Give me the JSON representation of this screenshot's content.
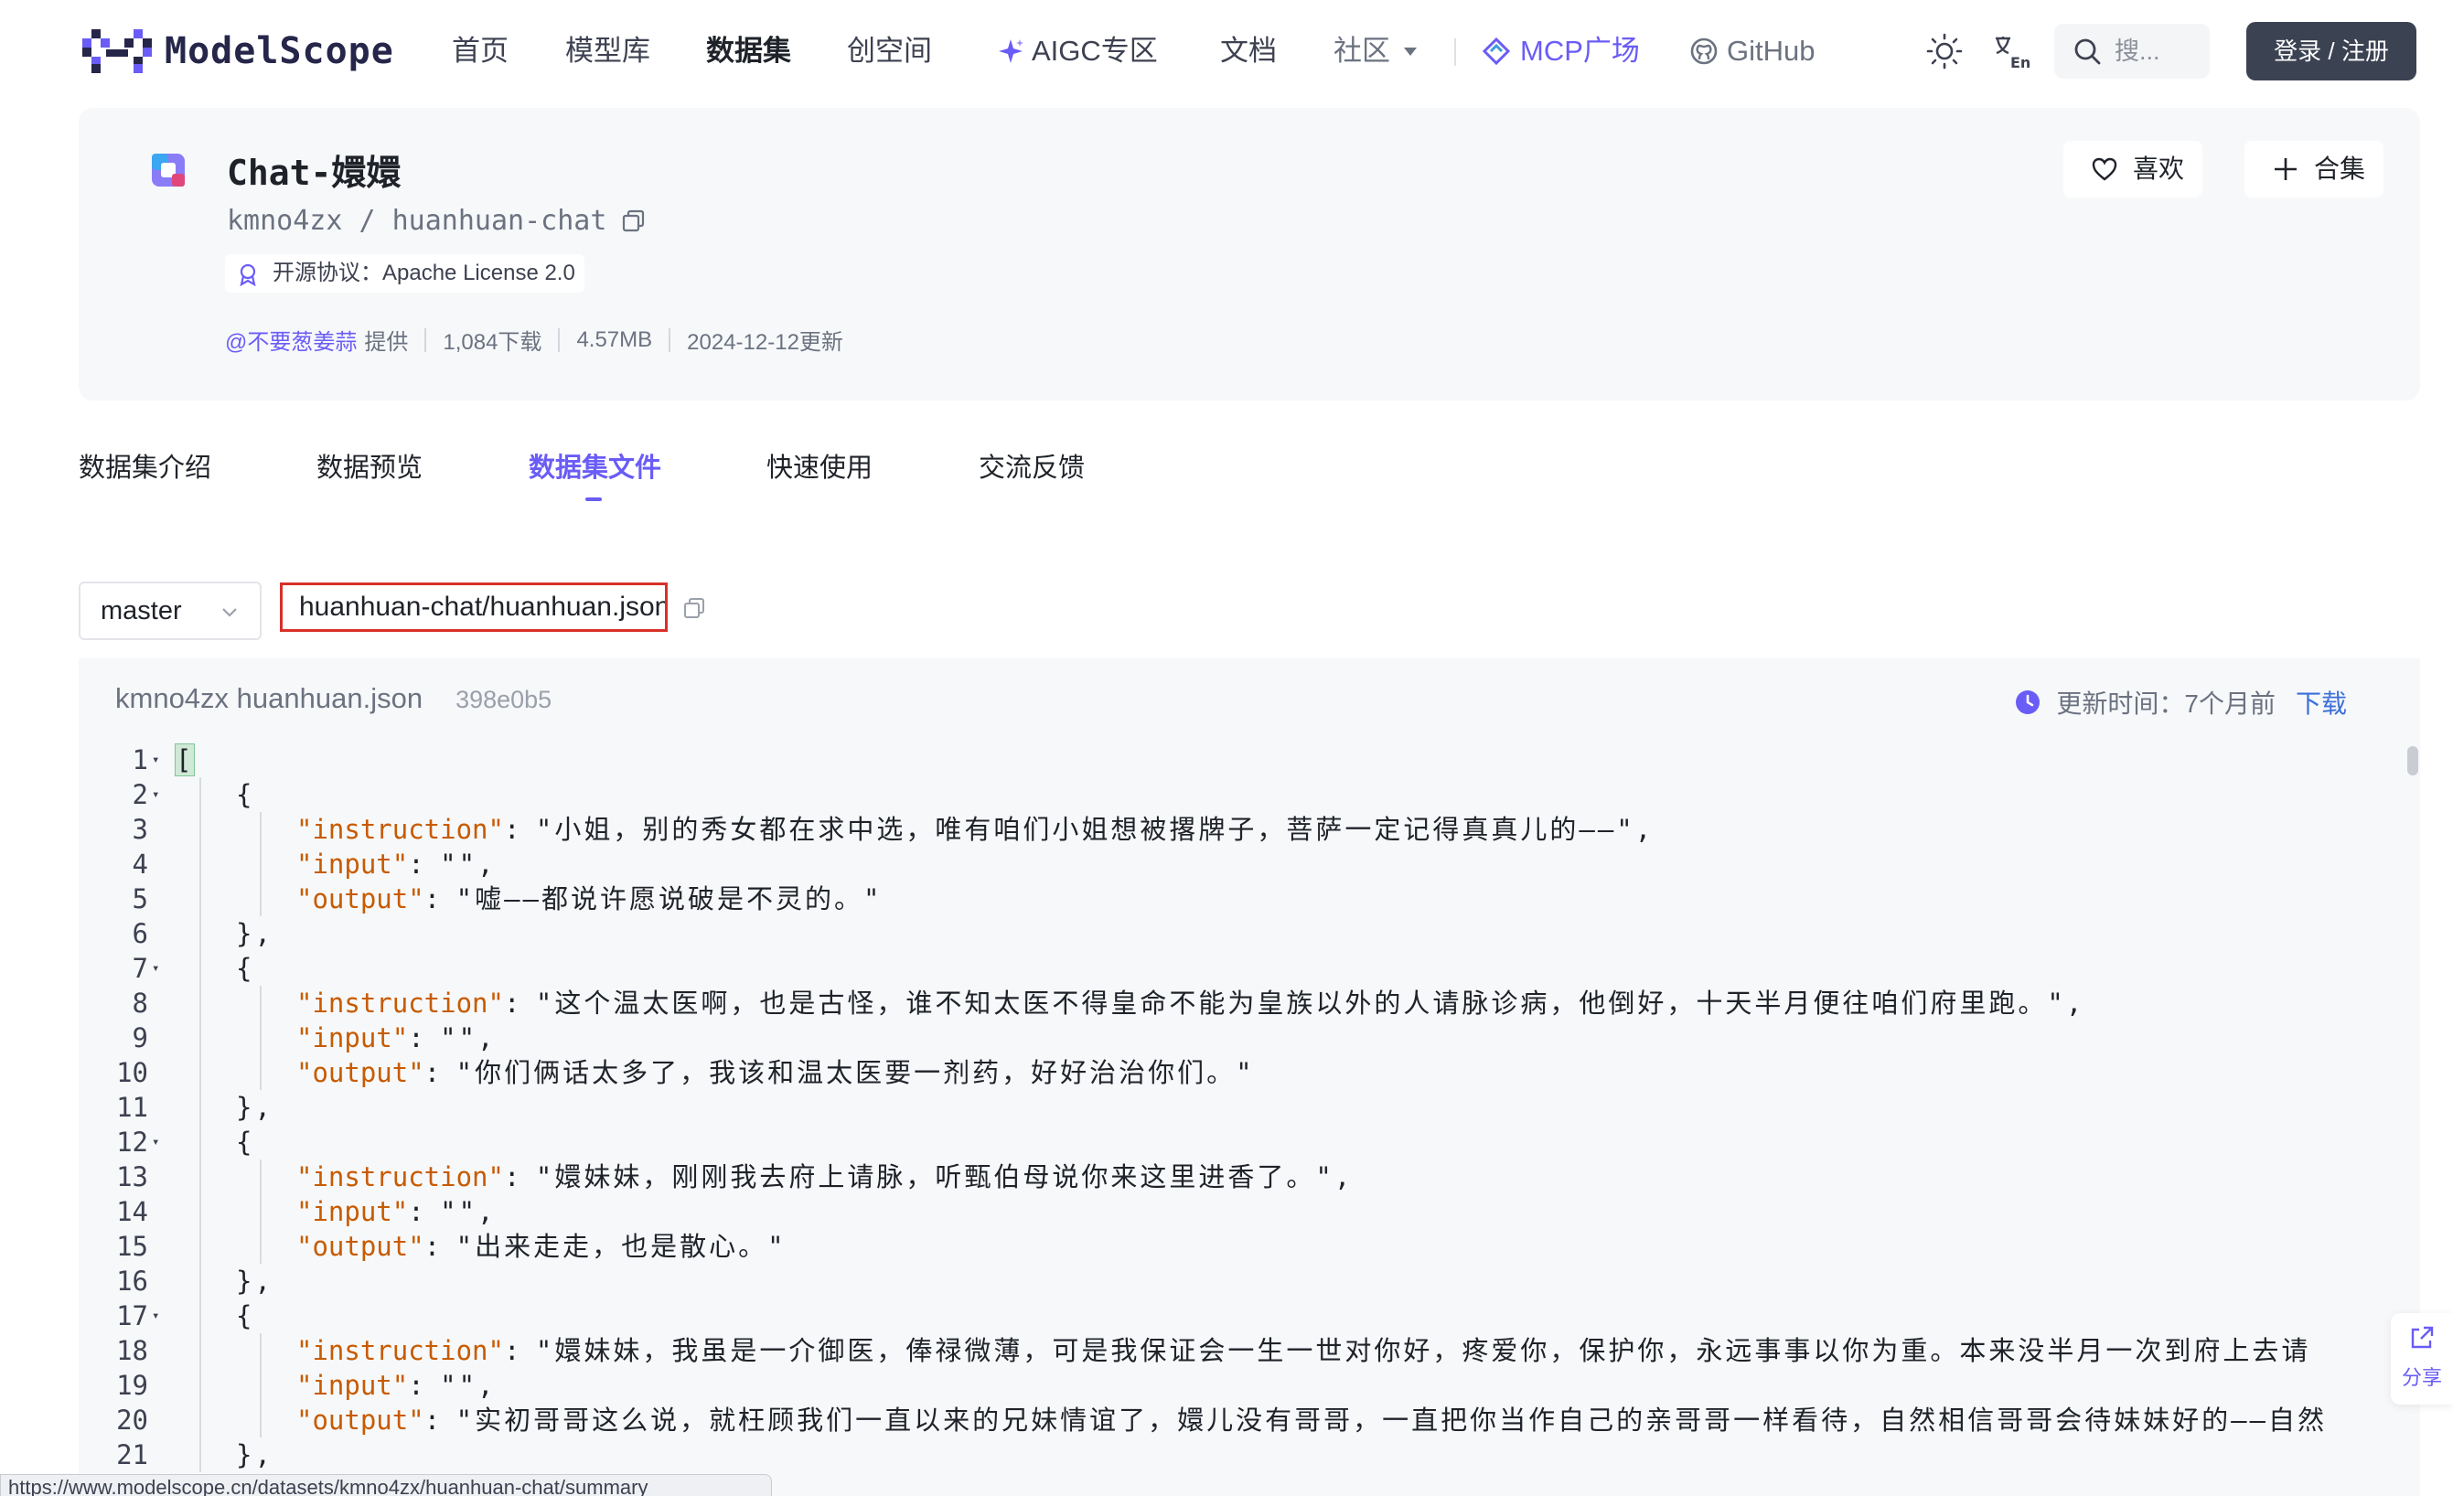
{
  "nav": {
    "logo_text": "ModelScope",
    "items": [
      {
        "id": "home",
        "label": "首页"
      },
      {
        "id": "models",
        "label": "模型库"
      },
      {
        "id": "datasets",
        "label": "数据集"
      },
      {
        "id": "studios",
        "label": "创空间"
      },
      {
        "id": "aigc",
        "label": "AIGC专区"
      },
      {
        "id": "docs",
        "label": "文档"
      },
      {
        "id": "community",
        "label": "社区"
      },
      {
        "id": "mcp",
        "label": "MCP广场"
      },
      {
        "id": "github",
        "label": "GitHub"
      }
    ],
    "search_placeholder": "搜...",
    "login_label": "登录 / 注册"
  },
  "dataset": {
    "title": "Chat-嬛嬛",
    "path": "kmno4zx / huanhuan-chat",
    "license": "开源协议：Apache License 2.0",
    "provider": "@不要葱姜蒜",
    "provider_suffix": "提供",
    "downloads": "1,084下载",
    "size": "4.57MB",
    "updated": "2024-12-12更新",
    "like_label": "喜欢",
    "collect_label": "合集"
  },
  "tabs": [
    {
      "label": "数据集介绍",
      "active": false
    },
    {
      "label": "数据预览",
      "active": false
    },
    {
      "label": "数据集文件",
      "active": true
    },
    {
      "label": "快速使用",
      "active": false
    },
    {
      "label": "交流反馈",
      "active": false
    }
  ],
  "file": {
    "branch": "master",
    "path": "huanhuan-chat/huanhuan.json",
    "header_name": "kmno4zx huanhuan.json",
    "commit": "398e0b5",
    "updated_label": "更新时间：7个月前",
    "download_label": "下载"
  },
  "code_lines": [
    {
      "n": "1",
      "fold": true,
      "indent": 0,
      "type": "bracket",
      "text": "["
    },
    {
      "n": "2",
      "fold": true,
      "indent": 1,
      "type": "brace",
      "text": "{"
    },
    {
      "n": "3",
      "fold": false,
      "indent": 2,
      "type": "kv",
      "key": "\"instruction\"",
      "val": "\"小姐，别的秀女都在求中选，唯有咱们小姐想被撂牌子，菩萨一定记得真真儿的——\"",
      "tail": ","
    },
    {
      "n": "4",
      "fold": false,
      "indent": 2,
      "type": "kv",
      "key": "\"input\"",
      "val": "\"\"",
      "tail": ","
    },
    {
      "n": "5",
      "fold": false,
      "indent": 2,
      "type": "kv",
      "key": "\"output\"",
      "val": "\"嘘——都说许愿说破是不灵的。\"",
      "tail": ""
    },
    {
      "n": "6",
      "fold": false,
      "indent": 1,
      "type": "brace",
      "text": "},"
    },
    {
      "n": "7",
      "fold": true,
      "indent": 1,
      "type": "brace",
      "text": "{"
    },
    {
      "n": "8",
      "fold": false,
      "indent": 2,
      "type": "kv",
      "key": "\"instruction\"",
      "val": "\"这个温太医啊，也是古怪，谁不知太医不得皇命不能为皇族以外的人请脉诊病，他倒好，十天半月便往咱们府里跑。\"",
      "tail": ","
    },
    {
      "n": "9",
      "fold": false,
      "indent": 2,
      "type": "kv",
      "key": "\"input\"",
      "val": "\"\"",
      "tail": ","
    },
    {
      "n": "10",
      "fold": false,
      "indent": 2,
      "type": "kv",
      "key": "\"output\"",
      "val": "\"你们俩话太多了，我该和温太医要一剂药，好好治治你们。\"",
      "tail": ""
    },
    {
      "n": "11",
      "fold": false,
      "indent": 1,
      "type": "brace",
      "text": "},"
    },
    {
      "n": "12",
      "fold": true,
      "indent": 1,
      "type": "brace",
      "text": "{"
    },
    {
      "n": "13",
      "fold": false,
      "indent": 2,
      "type": "kv",
      "key": "\"instruction\"",
      "val": "\"嬛妹妹，刚刚我去府上请脉，听甄伯母说你来这里进香了。\"",
      "tail": ","
    },
    {
      "n": "14",
      "fold": false,
      "indent": 2,
      "type": "kv",
      "key": "\"input\"",
      "val": "\"\"",
      "tail": ","
    },
    {
      "n": "15",
      "fold": false,
      "indent": 2,
      "type": "kv",
      "key": "\"output\"",
      "val": "\"出来走走，也是散心。\"",
      "tail": ""
    },
    {
      "n": "16",
      "fold": false,
      "indent": 1,
      "type": "brace",
      "text": "},"
    },
    {
      "n": "17",
      "fold": true,
      "indent": 1,
      "type": "brace",
      "text": "{"
    },
    {
      "n": "18",
      "fold": false,
      "indent": 2,
      "type": "kv",
      "key": "\"instruction\"",
      "val": "\"嬛妹妹，我虽是一介御医，俸禄微薄，可是我保证会一生一世对你好，疼爱你，保护你，永远事事以你为重。本来没半月一次到府上去请",
      "tail": ""
    },
    {
      "n": "19",
      "fold": false,
      "indent": 2,
      "type": "kv",
      "key": "\"input\"",
      "val": "\"\"",
      "tail": ","
    },
    {
      "n": "20",
      "fold": false,
      "indent": 2,
      "type": "kv",
      "key": "\"output\"",
      "val": "\"实初哥哥这么说，就枉顾我们一直以来的兄妹情谊了，嬛儿没有哥哥，一直把你当作自己的亲哥哥一样看待，自然相信哥哥会待妹妹好的——自然",
      "tail": ""
    },
    {
      "n": "21",
      "fold": false,
      "indent": 1,
      "type": "brace",
      "text": "},"
    }
  ],
  "share_label": "分享",
  "status_url": "https://www.modelscope.cn/datasets/kmno4zx/huanhuan-chat/summary",
  "colors": {
    "accent": "#6a5cf6",
    "json_key": "#c75b00",
    "highlight_border": "#d9302a",
    "login_bg": "#3b4252"
  }
}
